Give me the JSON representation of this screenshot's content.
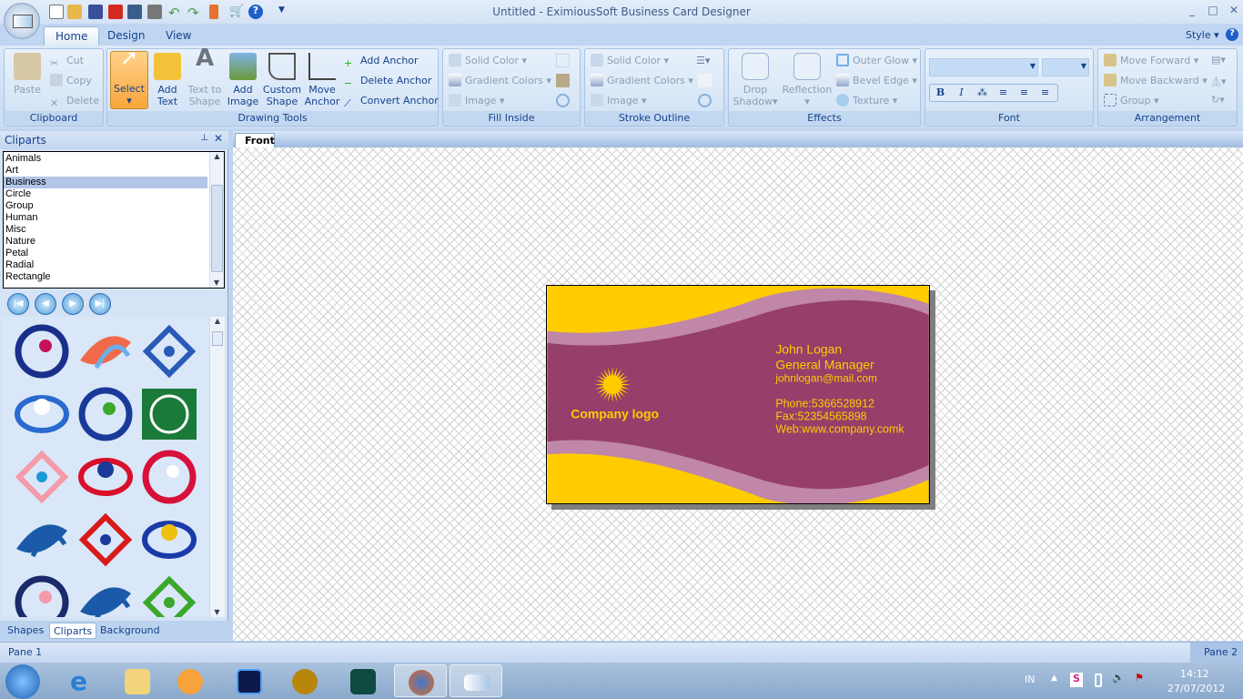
{
  "window": {
    "title": "Untitled - EximiousSoft Business Card Designer",
    "controls": [
      "_",
      "□",
      "✕"
    ]
  },
  "quick_access": [
    "new-icon",
    "open-icon",
    "save-icon",
    "pdf-icon",
    "image-export-icon",
    "print-icon",
    "undo-icon",
    "redo-icon",
    "paint-icon",
    "cart-icon",
    "help-icon"
  ],
  "tabs": [
    {
      "label": "Home",
      "selected": true
    },
    {
      "label": "Design"
    },
    {
      "label": "View"
    }
  ],
  "style_label": "Style",
  "ribbon": {
    "clipboard": {
      "label": "Clipboard",
      "paste": "Paste",
      "cut": "Cut",
      "copy": "Copy",
      "delete": "Delete"
    },
    "drawing": {
      "label": "Drawing Tools",
      "select": "Select",
      "add_text": "Add Text",
      "text_to_shape": "Text to Shape",
      "add_image": "Add Image",
      "custom_shape": "Custom Shape",
      "move_anchor": "Move Anchor",
      "add_anchor": "Add Anchor",
      "delete_anchor": "Delete Anchor",
      "convert_anchor": "Convert Anchor"
    },
    "fill": {
      "label": "Fill Inside",
      "solid": "Solid Color",
      "gradient": "Gradient Colors",
      "image": "Image"
    },
    "stroke": {
      "label": "Stroke Outline",
      "solid": "Solid Color",
      "gradient": "Gradient Colors",
      "image": "Image"
    },
    "effects": {
      "label": "Effects",
      "drop_shadow": "Drop Shadow",
      "reflection": "Reflection",
      "outer_glow": "Outer Glow",
      "bevel": "Bevel Edge",
      "texture": "Texture"
    },
    "font": {
      "label": "Font",
      "bold": "B",
      "italic": "I"
    },
    "arrangement": {
      "label": "Arrangement",
      "forward": "Move Forward",
      "backward": "Move Backward",
      "group": "Group"
    }
  },
  "left_panel": {
    "title": "Cliparts",
    "categories": [
      "Animals",
      "Art",
      "Business",
      "Circle",
      "Group",
      "Human",
      "Misc",
      "Nature",
      "Petal",
      "Radial",
      "Rectangle"
    ],
    "selected": "Business",
    "tabs": [
      "Shapes",
      "Cliparts",
      "Background"
    ],
    "selected_tab": "Cliparts"
  },
  "document": {
    "tab": "Front"
  },
  "card": {
    "name": "John Logan",
    "position": "General Manager",
    "email": "johnlogan@mail.com",
    "phone": "Phone:5366528912",
    "fax": "Fax:52354565898",
    "web": "Web:www.company.comk",
    "logo_text": "Company logo",
    "colors": {
      "yellow": "#ffcc00",
      "purple": "#963f6a",
      "band": "#c087a8"
    }
  },
  "status": {
    "pane1": "Pane 1",
    "pane2": "Pane 2"
  },
  "taskbar": {
    "lang": "IN",
    "time": "14:12",
    "date": "27/07/2012"
  }
}
